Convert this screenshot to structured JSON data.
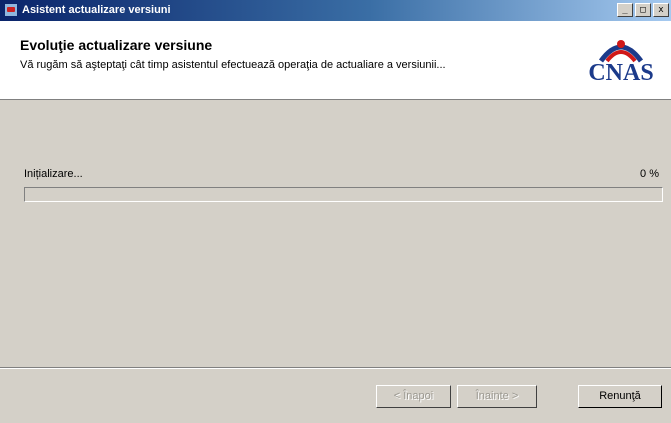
{
  "window": {
    "title": "Asistent actualizare versiuni",
    "controls": {
      "minimize": "_",
      "maximize": "□",
      "close": "x"
    }
  },
  "header": {
    "title": "Evoluţie actualizare versiune",
    "subtitle": "Vă rugăm să aşteptaţi cât timp asistentul efectuează operaţia de actualiare a versiunii...",
    "logo_text": "CNAS",
    "logo_icon": "cnas-logo-icon"
  },
  "progress": {
    "status_text": "Inițializare...",
    "percent_text": "0 %",
    "value": 0
  },
  "buttons": {
    "back": "< Înapoi",
    "next": "Înainte >",
    "cancel": "Renunţă"
  },
  "colors": {
    "titlebar_start": "#0a246a",
    "titlebar_end": "#a6caf0",
    "logo_blue": "#1b3a8a",
    "logo_red": "#d01818",
    "dialog_bg": "#d4d0c8"
  }
}
